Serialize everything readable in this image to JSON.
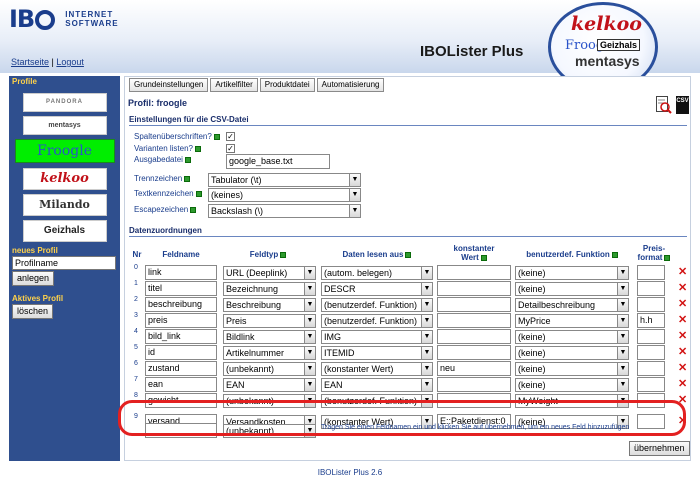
{
  "header": {
    "logo_mark": "IB",
    "logo_line1": "INTERNET",
    "logo_line2": "SOFTWARE",
    "link_start": "Startseite",
    "link_sep": "|",
    "link_logout": "Logout",
    "product_title": "IBOLister Plus",
    "badge": {
      "kelkoo": "kelkoo",
      "froogle": "Froogle",
      "geizhals": "Geizhals",
      "mentasys": "mentasys"
    }
  },
  "sidebar": {
    "profile_title": "Profile",
    "profiles": [
      "PANDORA",
      "mentasys",
      "Froogle",
      "kelkoo",
      "Milando",
      "Geizhals"
    ],
    "new_profile_title": "neues Profil",
    "new_profile_value": "Profilname",
    "create_button": "anlegen",
    "active_profile_title": "Aktives Profil",
    "delete_button": "löschen"
  },
  "tabs": [
    "Grundeinstellungen",
    "Artikelfilter",
    "Produktdatei",
    "Automatisierung"
  ],
  "profile_heading": "Profil: froogle",
  "icons": {
    "preview": "magnify-icon",
    "csv": "csv-file-icon",
    "info": "info-icon",
    "delete": "delete-x-icon"
  },
  "colors": {
    "sidebar": "#2f4f8e",
    "accent": "#1a3d8c",
    "active_profile": "#00ee00",
    "highlight": "#e32020"
  },
  "csv": {
    "title": "Einstellungen für die CSV-Datei",
    "spalten_label": "Spaltenüberschriften?",
    "spalten_checked": "✓",
    "varianten_label": "Varianten listen?",
    "varianten_checked": "✓",
    "ausgabe_label": "Ausgabedatei",
    "ausgabe_value": "google_base.txt",
    "trenn_label": "Trennzeichen",
    "trenn_value": "Tabulator (\\t)",
    "text_label": "Textkennzeichen",
    "text_value": "(keines)",
    "escape_label": "Escapezeichen",
    "escape_value": "Backslash (\\)"
  },
  "mapping": {
    "title": "Datenzuordnungen",
    "headers": {
      "nr": "Nr",
      "feldname": "Feldname",
      "feldtyp": "Feldtyp",
      "daten": "Daten lesen aus",
      "konstant1": "konstanter",
      "konstant2": "Wert",
      "funktion": "benutzerdef. Funktion",
      "preis1": "Preis-",
      "preis2": "format"
    },
    "rows": [
      {
        "nr": "0",
        "feld": "link",
        "typ": "URL (Deeplink)",
        "daten": "(autom. belegen)",
        "konst": "",
        "funk": "(keine)",
        "preis": ""
      },
      {
        "nr": "1",
        "feld": "titel",
        "typ": "Bezeichnung",
        "daten": "DESCR",
        "konst": "",
        "funk": "(keine)",
        "preis": ""
      },
      {
        "nr": "2",
        "feld": "beschreibung",
        "typ": "Beschreibung",
        "daten": "(benutzerdef. Funktion)",
        "konst": "",
        "funk": "Detailbeschreibung",
        "preis": ""
      },
      {
        "nr": "3",
        "feld": "preis",
        "typ": "Preis",
        "daten": "(benutzerdef. Funktion)",
        "konst": "",
        "funk": "MyPrice",
        "preis": "h.h"
      },
      {
        "nr": "4",
        "feld": "bild_link",
        "typ": "Bildlink",
        "daten": "IMG",
        "konst": "",
        "funk": "(keine)",
        "preis": ""
      },
      {
        "nr": "5",
        "feld": "id",
        "typ": "Artikelnummer",
        "daten": "ITEMID",
        "konst": "",
        "funk": "(keine)",
        "preis": ""
      },
      {
        "nr": "6",
        "feld": "zustand",
        "typ": "(unbekannt)",
        "daten": "(konstanter Wert)",
        "konst": "neu",
        "funk": "(keine)",
        "preis": ""
      },
      {
        "nr": "7",
        "feld": "ean",
        "typ": "EAN",
        "daten": "EAN",
        "konst": "",
        "funk": "(keine)",
        "preis": ""
      },
      {
        "nr": "8",
        "feld": "gewicht",
        "typ": "(unbekannt)",
        "daten": "(benutzerdef. Funktion)",
        "konst": "",
        "funk": "MyWeight",
        "preis": ""
      },
      {
        "nr": "9",
        "feld": "versand",
        "typ": "Versandkosten",
        "daten": "(konstanter Wert)",
        "konst": "E::Paketdienst:0",
        "funk": "(keine)",
        "preis": ""
      }
    ],
    "new_row": {
      "feld": "",
      "typ": "(unbekannt)"
    },
    "hint": "Tragen Sie einen Feldnamen ein und klicken Sie auf übernehmen, um ein neues Feld hinzuzufügen",
    "submit": "übernehmen"
  },
  "footer": "IBOLister Plus 2.6"
}
